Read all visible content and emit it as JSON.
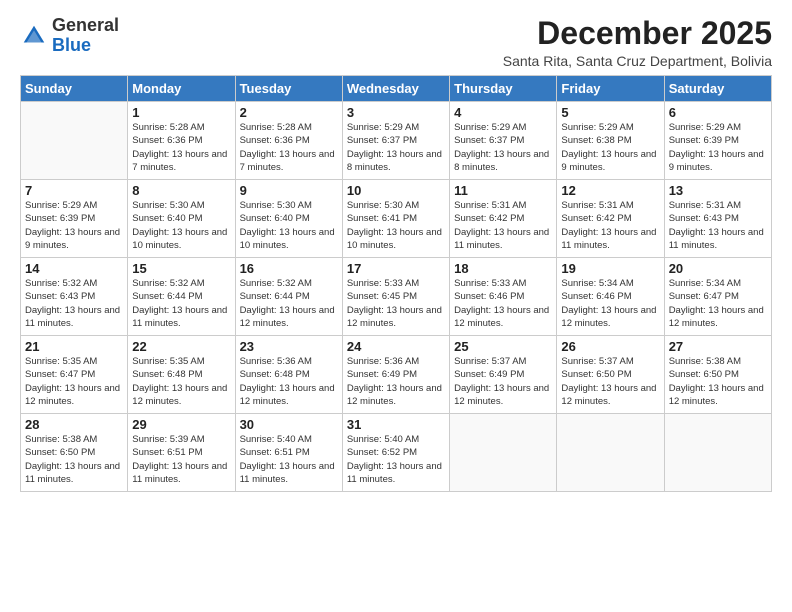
{
  "header": {
    "logo_general": "General",
    "logo_blue": "Blue",
    "month_title": "December 2025",
    "location": "Santa Rita, Santa Cruz Department, Bolivia"
  },
  "days_of_week": [
    "Sunday",
    "Monday",
    "Tuesday",
    "Wednesday",
    "Thursday",
    "Friday",
    "Saturday"
  ],
  "weeks": [
    [
      {
        "day": "",
        "sunrise": "",
        "sunset": "",
        "daylight": ""
      },
      {
        "day": "1",
        "sunrise": "Sunrise: 5:28 AM",
        "sunset": "Sunset: 6:36 PM",
        "daylight": "Daylight: 13 hours and 7 minutes."
      },
      {
        "day": "2",
        "sunrise": "Sunrise: 5:28 AM",
        "sunset": "Sunset: 6:36 PM",
        "daylight": "Daylight: 13 hours and 7 minutes."
      },
      {
        "day": "3",
        "sunrise": "Sunrise: 5:29 AM",
        "sunset": "Sunset: 6:37 PM",
        "daylight": "Daylight: 13 hours and 8 minutes."
      },
      {
        "day": "4",
        "sunrise": "Sunrise: 5:29 AM",
        "sunset": "Sunset: 6:37 PM",
        "daylight": "Daylight: 13 hours and 8 minutes."
      },
      {
        "day": "5",
        "sunrise": "Sunrise: 5:29 AM",
        "sunset": "Sunset: 6:38 PM",
        "daylight": "Daylight: 13 hours and 9 minutes."
      },
      {
        "day": "6",
        "sunrise": "Sunrise: 5:29 AM",
        "sunset": "Sunset: 6:39 PM",
        "daylight": "Daylight: 13 hours and 9 minutes."
      }
    ],
    [
      {
        "day": "7",
        "sunrise": "Sunrise: 5:29 AM",
        "sunset": "Sunset: 6:39 PM",
        "daylight": "Daylight: 13 hours and 9 minutes."
      },
      {
        "day": "8",
        "sunrise": "Sunrise: 5:30 AM",
        "sunset": "Sunset: 6:40 PM",
        "daylight": "Daylight: 13 hours and 10 minutes."
      },
      {
        "day": "9",
        "sunrise": "Sunrise: 5:30 AM",
        "sunset": "Sunset: 6:40 PM",
        "daylight": "Daylight: 13 hours and 10 minutes."
      },
      {
        "day": "10",
        "sunrise": "Sunrise: 5:30 AM",
        "sunset": "Sunset: 6:41 PM",
        "daylight": "Daylight: 13 hours and 10 minutes."
      },
      {
        "day": "11",
        "sunrise": "Sunrise: 5:31 AM",
        "sunset": "Sunset: 6:42 PM",
        "daylight": "Daylight: 13 hours and 11 minutes."
      },
      {
        "day": "12",
        "sunrise": "Sunrise: 5:31 AM",
        "sunset": "Sunset: 6:42 PM",
        "daylight": "Daylight: 13 hours and 11 minutes."
      },
      {
        "day": "13",
        "sunrise": "Sunrise: 5:31 AM",
        "sunset": "Sunset: 6:43 PM",
        "daylight": "Daylight: 13 hours and 11 minutes."
      }
    ],
    [
      {
        "day": "14",
        "sunrise": "Sunrise: 5:32 AM",
        "sunset": "Sunset: 6:43 PM",
        "daylight": "Daylight: 13 hours and 11 minutes."
      },
      {
        "day": "15",
        "sunrise": "Sunrise: 5:32 AM",
        "sunset": "Sunset: 6:44 PM",
        "daylight": "Daylight: 13 hours and 11 minutes."
      },
      {
        "day": "16",
        "sunrise": "Sunrise: 5:32 AM",
        "sunset": "Sunset: 6:44 PM",
        "daylight": "Daylight: 13 hours and 12 minutes."
      },
      {
        "day": "17",
        "sunrise": "Sunrise: 5:33 AM",
        "sunset": "Sunset: 6:45 PM",
        "daylight": "Daylight: 13 hours and 12 minutes."
      },
      {
        "day": "18",
        "sunrise": "Sunrise: 5:33 AM",
        "sunset": "Sunset: 6:46 PM",
        "daylight": "Daylight: 13 hours and 12 minutes."
      },
      {
        "day": "19",
        "sunrise": "Sunrise: 5:34 AM",
        "sunset": "Sunset: 6:46 PM",
        "daylight": "Daylight: 13 hours and 12 minutes."
      },
      {
        "day": "20",
        "sunrise": "Sunrise: 5:34 AM",
        "sunset": "Sunset: 6:47 PM",
        "daylight": "Daylight: 13 hours and 12 minutes."
      }
    ],
    [
      {
        "day": "21",
        "sunrise": "Sunrise: 5:35 AM",
        "sunset": "Sunset: 6:47 PM",
        "daylight": "Daylight: 13 hours and 12 minutes."
      },
      {
        "day": "22",
        "sunrise": "Sunrise: 5:35 AM",
        "sunset": "Sunset: 6:48 PM",
        "daylight": "Daylight: 13 hours and 12 minutes."
      },
      {
        "day": "23",
        "sunrise": "Sunrise: 5:36 AM",
        "sunset": "Sunset: 6:48 PM",
        "daylight": "Daylight: 13 hours and 12 minutes."
      },
      {
        "day": "24",
        "sunrise": "Sunrise: 5:36 AM",
        "sunset": "Sunset: 6:49 PM",
        "daylight": "Daylight: 13 hours and 12 minutes."
      },
      {
        "day": "25",
        "sunrise": "Sunrise: 5:37 AM",
        "sunset": "Sunset: 6:49 PM",
        "daylight": "Daylight: 13 hours and 12 minutes."
      },
      {
        "day": "26",
        "sunrise": "Sunrise: 5:37 AM",
        "sunset": "Sunset: 6:50 PM",
        "daylight": "Daylight: 13 hours and 12 minutes."
      },
      {
        "day": "27",
        "sunrise": "Sunrise: 5:38 AM",
        "sunset": "Sunset: 6:50 PM",
        "daylight": "Daylight: 13 hours and 12 minutes."
      }
    ],
    [
      {
        "day": "28",
        "sunrise": "Sunrise: 5:38 AM",
        "sunset": "Sunset: 6:50 PM",
        "daylight": "Daylight: 13 hours and 11 minutes."
      },
      {
        "day": "29",
        "sunrise": "Sunrise: 5:39 AM",
        "sunset": "Sunset: 6:51 PM",
        "daylight": "Daylight: 13 hours and 11 minutes."
      },
      {
        "day": "30",
        "sunrise": "Sunrise: 5:40 AM",
        "sunset": "Sunset: 6:51 PM",
        "daylight": "Daylight: 13 hours and 11 minutes."
      },
      {
        "day": "31",
        "sunrise": "Sunrise: 5:40 AM",
        "sunset": "Sunset: 6:52 PM",
        "daylight": "Daylight: 13 hours and 11 minutes."
      },
      {
        "day": "",
        "sunrise": "",
        "sunset": "",
        "daylight": ""
      },
      {
        "day": "",
        "sunrise": "",
        "sunset": "",
        "daylight": ""
      },
      {
        "day": "",
        "sunrise": "",
        "sunset": "",
        "daylight": ""
      }
    ]
  ]
}
